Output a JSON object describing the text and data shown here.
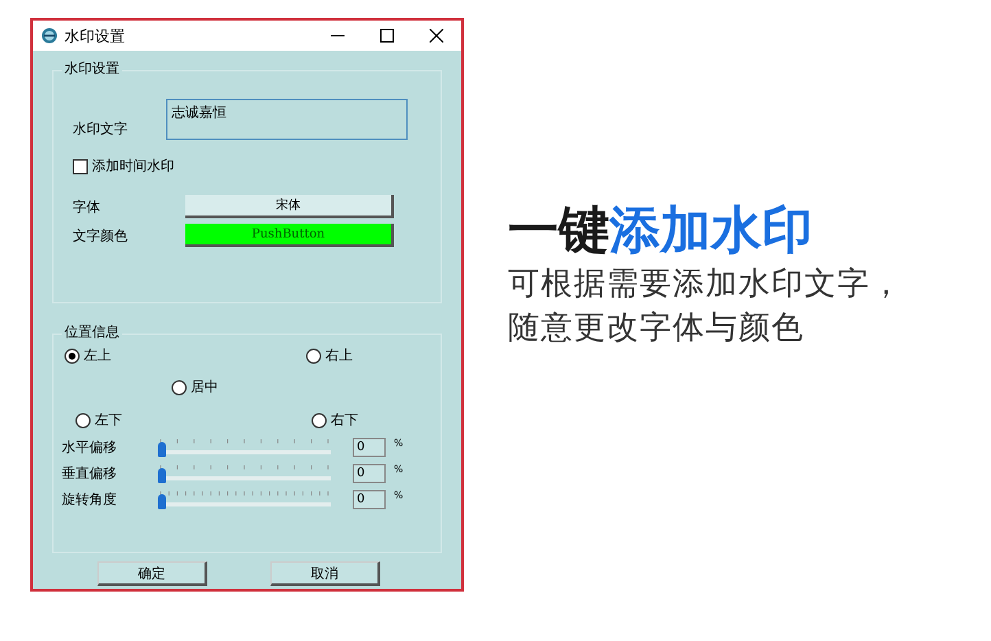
{
  "window": {
    "title": "水印设置"
  },
  "watermark_group": {
    "title": "水印设置",
    "text_label": "水印文字",
    "text_value": "志诚嘉恒",
    "time_checkbox": {
      "label": "添加时间水印",
      "checked": false
    },
    "font_label": "字体",
    "font_button": "宋体",
    "color_label": "文字颜色",
    "color_button": {
      "label": "PushButton",
      "color": "#00ff00"
    }
  },
  "position_group": {
    "title": "位置信息",
    "radios": [
      {
        "label": "左上",
        "selected": true
      },
      {
        "label": "右上",
        "selected": false
      },
      {
        "label": "居中",
        "selected": false
      },
      {
        "label": "左下",
        "selected": false
      },
      {
        "label": "右下",
        "selected": false
      }
    ],
    "sliders": [
      {
        "label": "水平偏移",
        "level": 0,
        "value": "0",
        "unit": "%"
      },
      {
        "label": "垂直偏移",
        "level": 0,
        "value": "0",
        "unit": "%"
      },
      {
        "label": "旋转角度",
        "level": 0,
        "value": "0",
        "unit": "%"
      }
    ]
  },
  "buttons": [
    "确定",
    "取消"
  ],
  "headline": [
    {
      "text": "一键",
      "color": "#1a1a1a"
    },
    {
      "text": "添加水印",
      "color": "#1a6fe0"
    }
  ],
  "description": [
    "可根据需要添加水印文字，",
    "随意更改字体与颜色"
  ]
}
